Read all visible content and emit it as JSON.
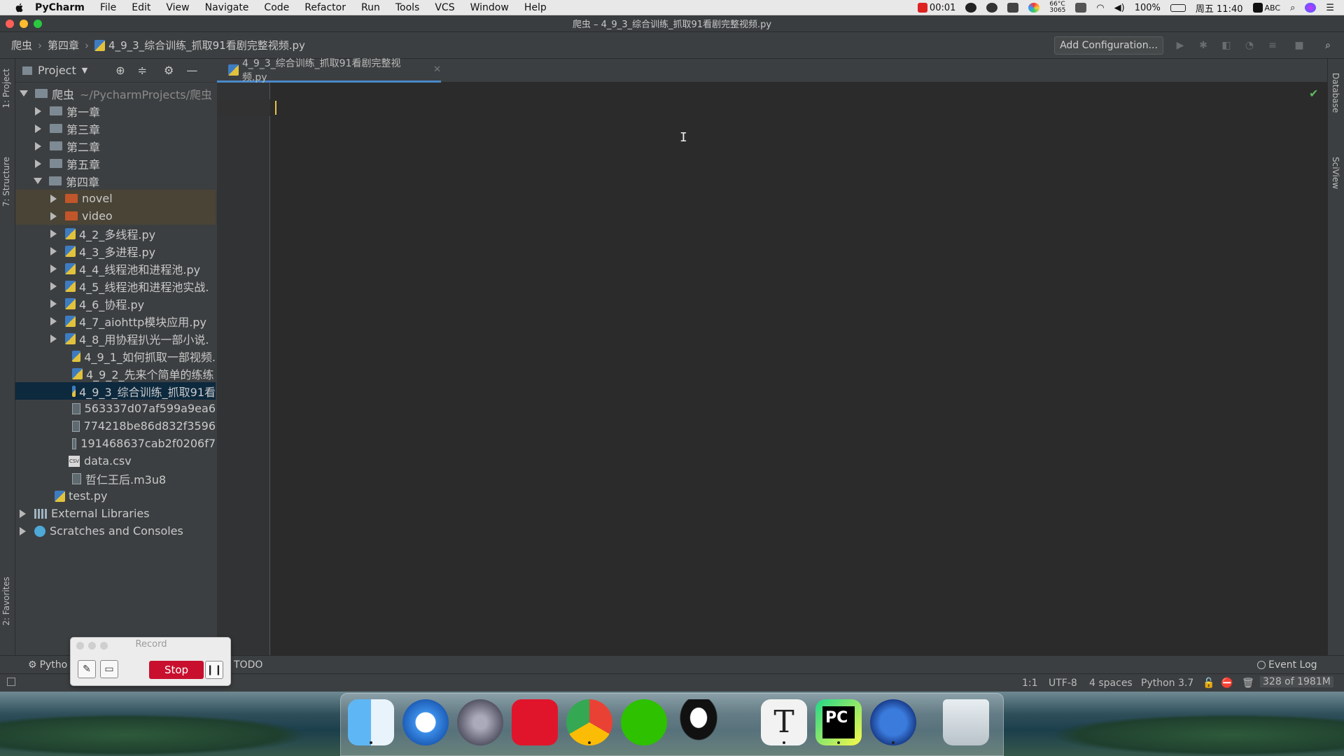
{
  "menubar": {
    "items": [
      "PyCharm",
      "File",
      "Edit",
      "View",
      "Navigate",
      "Code",
      "Refactor",
      "Run",
      "Tools",
      "VCS",
      "Window",
      "Help"
    ],
    "record_time": "00:01",
    "temp_top": "66°C",
    "temp_bottom": "3065",
    "battery": "100%",
    "clock": "周五 11:40",
    "input_method": "ABC"
  },
  "window": {
    "title": "爬虫 – 4_9_3_综合训练_抓取91看剧完整视频.py"
  },
  "navbar": {
    "crumbs": [
      "爬虫",
      "第四章",
      "4_9_3_综合训练_抓取91看剧完整视频.py"
    ],
    "add_config": "Add Configuration..."
  },
  "tool_windows": {
    "project": "1: Project",
    "structure": "7: Structure",
    "favorites": "2: Favorites",
    "database": "Database",
    "sciview": "SciView"
  },
  "project_panel": {
    "title": "Project",
    "root_name": "爬虫",
    "root_path": "~/PycharmProjects/爬虫",
    "items": [
      {
        "label": "第一章"
      },
      {
        "label": "第三章"
      },
      {
        "label": "第二章"
      },
      {
        "label": "第五章"
      },
      {
        "label": "第四章"
      },
      {
        "label": "novel"
      },
      {
        "label": "video"
      },
      {
        "label": "4_2_多线程.py"
      },
      {
        "label": "4_3_多进程.py"
      },
      {
        "label": "4_4_线程池和进程池.py"
      },
      {
        "label": "4_5_线程池和进程池实战."
      },
      {
        "label": "4_6_协程.py"
      },
      {
        "label": "4_7_aiohttp模块应用.py"
      },
      {
        "label": "4_8_用协程扒光一部小说."
      },
      {
        "label": "4_9_1_如何抓取一部视频."
      },
      {
        "label": "4_9_2_先来个简单的练练"
      },
      {
        "label": "4_9_3_综合训练_抓取91看"
      },
      {
        "label": "563337d07af599a9ea6"
      },
      {
        "label": "774218be86d832f3596"
      },
      {
        "label": "191468637cab2f0206f7"
      },
      {
        "label": "data.csv"
      },
      {
        "label": "哲仁王后.m3u8"
      },
      {
        "label": "test.py"
      },
      {
        "label": "External Libraries"
      },
      {
        "label": "Scratches and Consoles"
      }
    ]
  },
  "editor": {
    "tab_label": "4_9_3_综合训练_抓取91看剧完整视频.py"
  },
  "bottom_tools": {
    "python": "Pytho",
    "todo": "TODO",
    "event_log": "Event Log"
  },
  "statusbar": {
    "position": "1:1",
    "encoding": "UTF-8",
    "indent": "4 spaces",
    "interpreter": "Python 3.7",
    "memory": "328 of 1981M"
  },
  "record_widget": {
    "title": "Record",
    "stop": "Stop"
  },
  "colors": {
    "accent": "#4a88c7",
    "selection": "#0d293e",
    "stop": "#c8102e"
  }
}
